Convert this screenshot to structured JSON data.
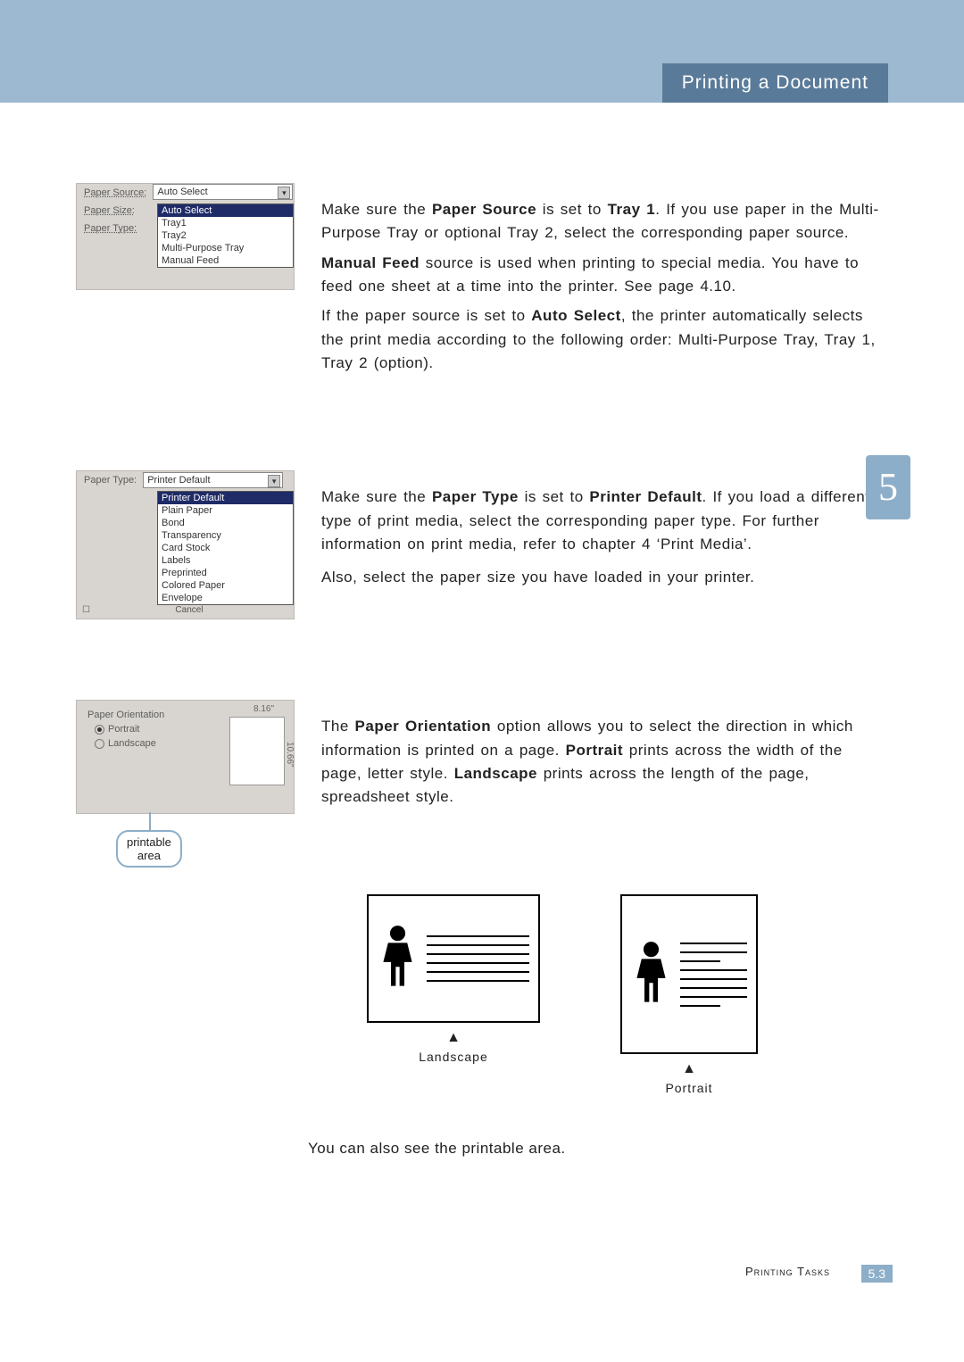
{
  "header": {
    "title": "Printing a Document"
  },
  "chapter_tab": "5",
  "section1": {
    "screenshot": {
      "label_source": "Paper Source:",
      "label_size": "Paper Size:",
      "label_type": "Paper Type:",
      "field_source_value": "Auto Select",
      "options": [
        "Auto Select",
        "Tray1",
        "Tray2",
        "Multi-Purpose Tray",
        "Manual Feed"
      ]
    },
    "text_parts": {
      "t1a": "Make sure the ",
      "t1b": "Paper Source",
      "t1c": " is set to ",
      "t1d": "Tray 1",
      "t1e": ". If you use paper in the Multi-Purpose Tray or optional Tray 2, select the corresponding paper source.",
      "t2a": "Manual Feed",
      "t2b": " source is used when printing to special media. You have to feed one sheet at a time into the printer. See page 4.10.",
      "t3a": "If the paper source is set to ",
      "t3b": "Auto Select",
      "t3c": ", the printer automatically selects the print media according to the following order: Multi-Purpose Tray, Tray 1, Tray 2 (option)."
    }
  },
  "section2": {
    "screenshot": {
      "label_type": "Paper Type:",
      "field_type_value": "Printer Default",
      "options": [
        "Printer Default",
        "Plain Paper",
        "Bond",
        "Transparency",
        "Card Stock",
        "Labels",
        "Preprinted",
        "Colored Paper",
        "Envelope"
      ],
      "cancel": "Cancel"
    },
    "text_parts": {
      "t1a": "Make sure the ",
      "t1b": "Paper Type",
      "t1c": " is set to ",
      "t1d": "Printer Default",
      "t1e": ". If you load a different type of print media, select the corresponding paper type. For further information on print media, refer to chapter 4 ‘Print Media’.",
      "t2": "Also, select the paper size you have loaded in your printer."
    }
  },
  "section3": {
    "screenshot": {
      "group": "Paper Orientation",
      "opt_portrait": "Portrait",
      "opt_landscape": "Landscape",
      "width": "8.16\"",
      "height": "10.66\"",
      "callout_l1": "printable",
      "callout_l2": "area"
    },
    "text_parts": {
      "t1a": "The ",
      "t1b": "Paper Orientation",
      "t1c": " option allows you to select the direction in which information is printed on a page. ",
      "t1d": "Portrait",
      "t1e": " prints across the width of the page, letter style. ",
      "t1f": "Landscape",
      "t1g": " prints across the length of the page, spreadsheet style."
    },
    "diagram": {
      "landscape": "Landscape",
      "portrait": "Portrait",
      "arrow": "▲"
    },
    "final": "You can also see the printable area."
  },
  "footer": {
    "text": "Printing Tasks",
    "page": "5.3"
  }
}
